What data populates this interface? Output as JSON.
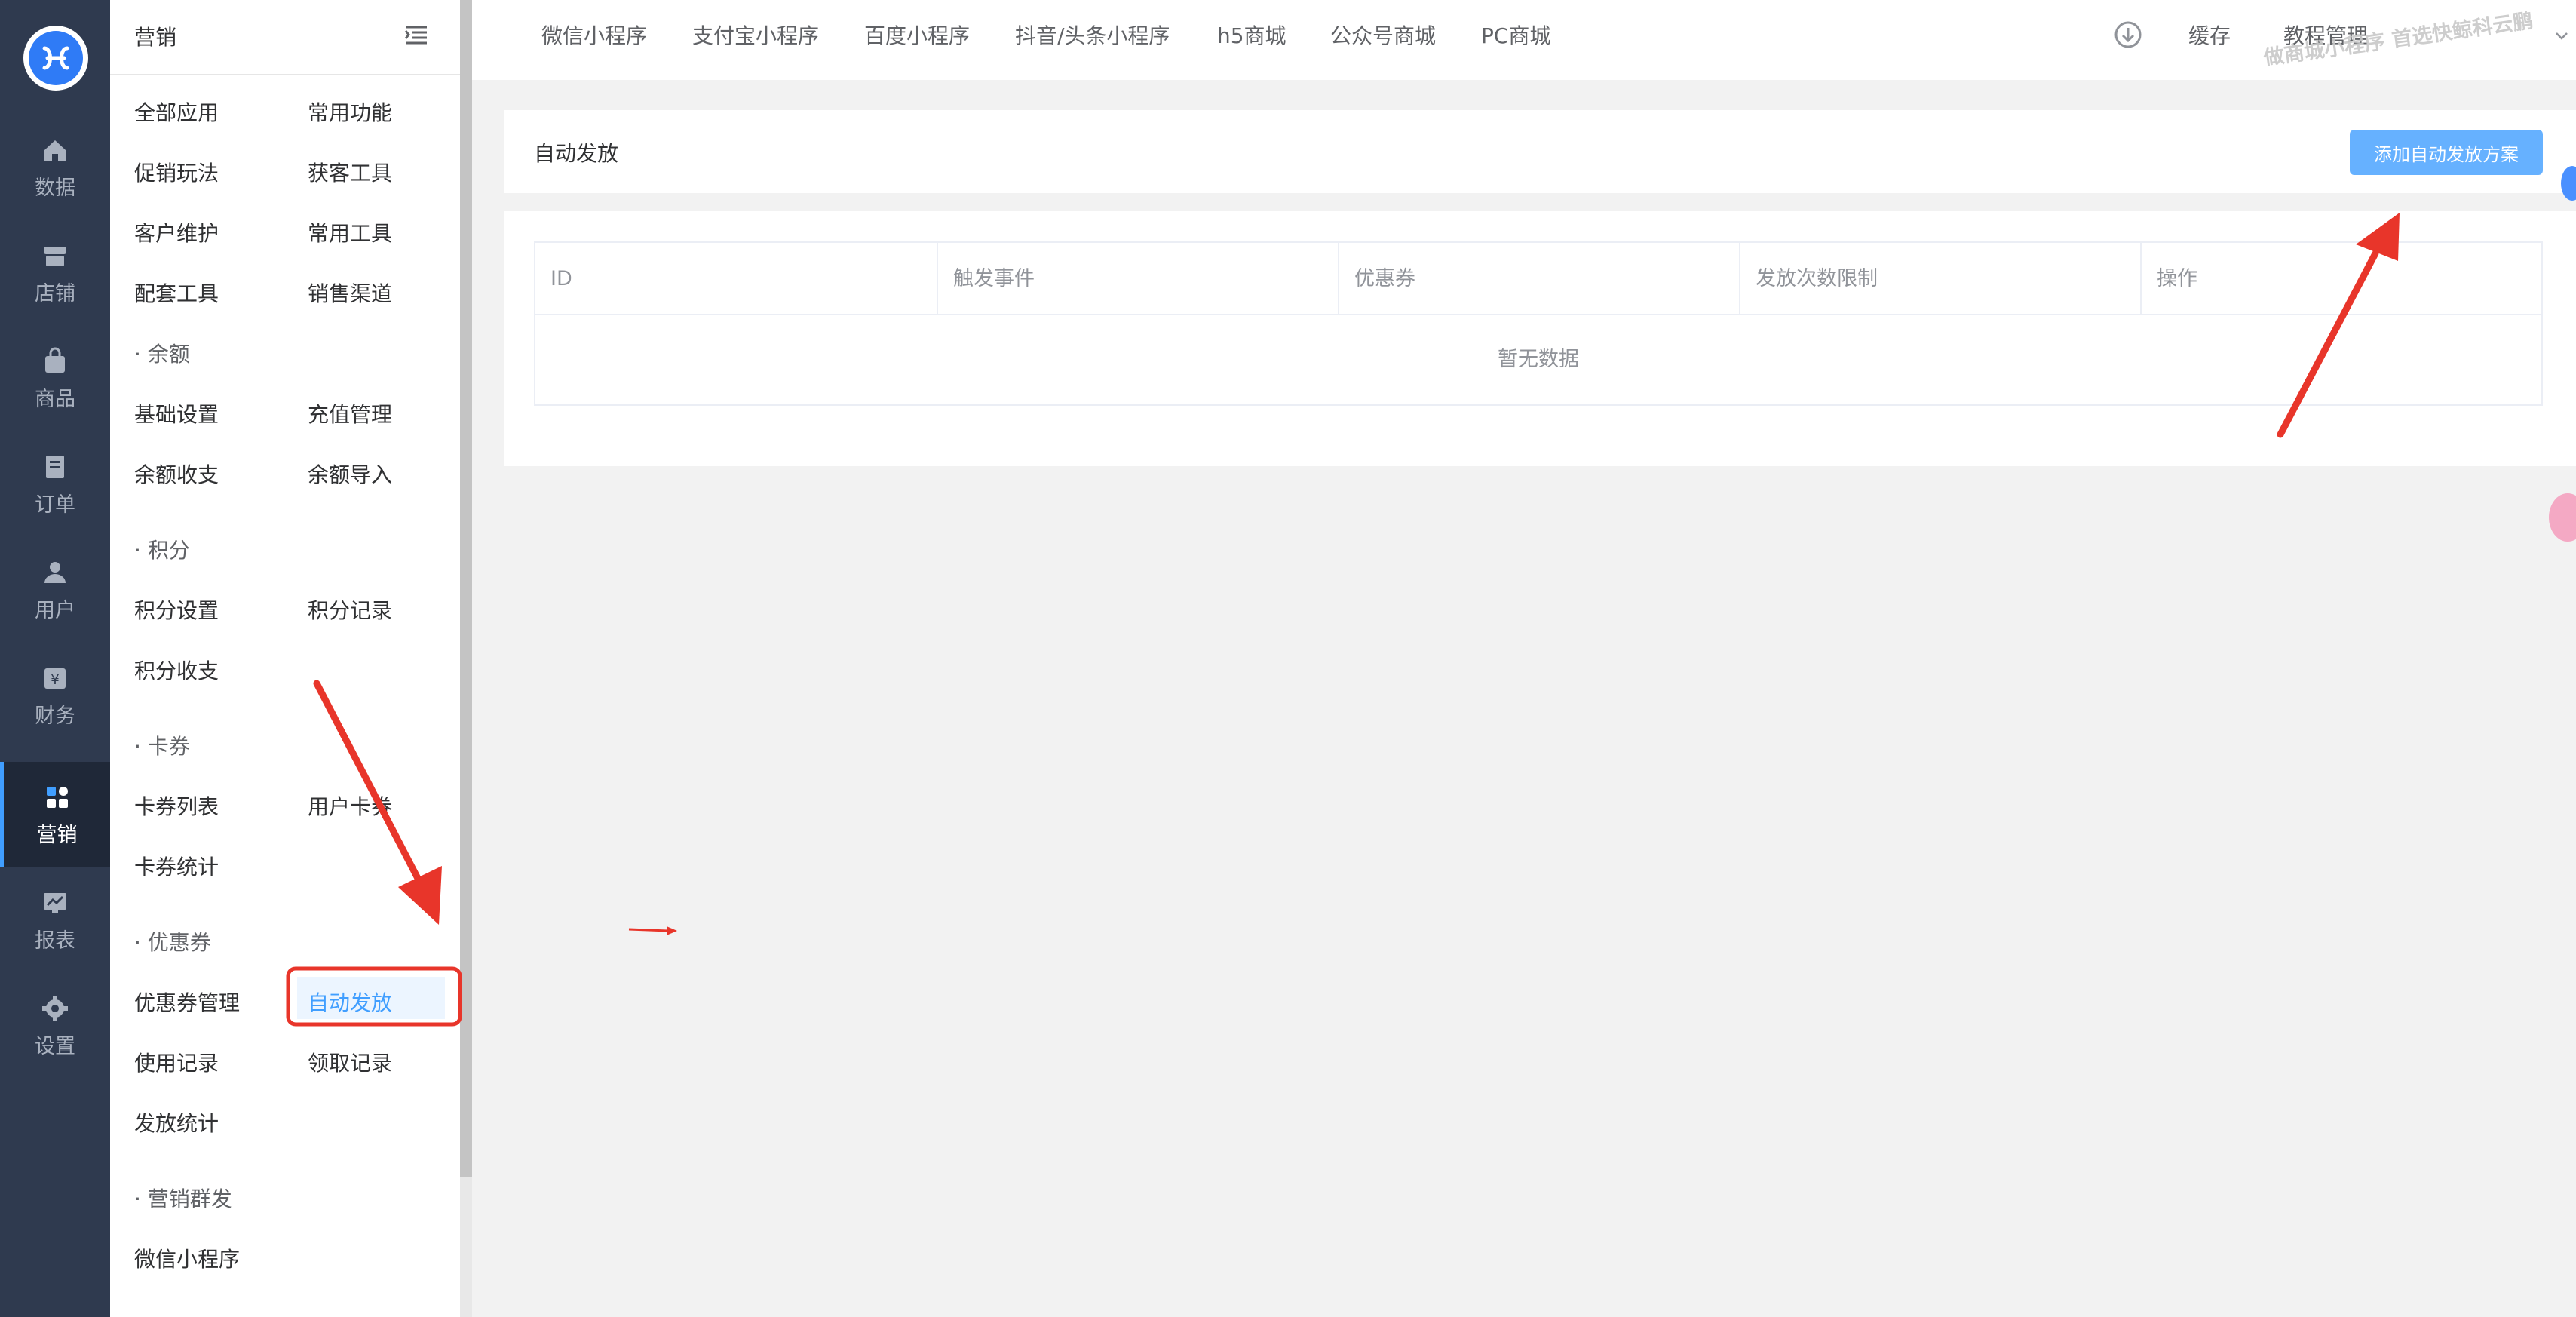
{
  "rail": {
    "items": [
      {
        "label": "数据",
        "icon": "home-icon"
      },
      {
        "label": "店铺",
        "icon": "store-icon"
      },
      {
        "label": "商品",
        "icon": "bag-icon"
      },
      {
        "label": "订单",
        "icon": "order-icon"
      },
      {
        "label": "用户",
        "icon": "user-icon"
      },
      {
        "label": "财务",
        "icon": "finance-icon"
      },
      {
        "label": "营销",
        "icon": "grid-icon"
      },
      {
        "label": "报表",
        "icon": "chart-icon"
      },
      {
        "label": "设置",
        "icon": "gear-icon"
      }
    ],
    "active": "营销"
  },
  "menu": {
    "title": "营销",
    "row1": [
      "全部应用",
      "常用功能"
    ],
    "row2": [
      "促销玩法",
      "获客工具"
    ],
    "row3": [
      "客户维护",
      "常用工具"
    ],
    "row4": [
      "配套工具",
      "销售渠道"
    ],
    "sec_balance": "· 余额",
    "balance1": [
      "基础设置",
      "充值管理"
    ],
    "balance2": [
      "余额收支",
      "余额导入"
    ],
    "sec_points": "· 积分",
    "points1": [
      "积分设置",
      "积分记录"
    ],
    "points2": [
      "积分收支"
    ],
    "sec_cards": "· 卡券",
    "cards1": [
      "卡券列表",
      "用户卡券"
    ],
    "cards2": [
      "卡券统计"
    ],
    "sec_coupon": "· 优惠券",
    "coupon1": [
      "优惠券管理",
      "自动发放"
    ],
    "coupon2": [
      "使用记录",
      "领取记录"
    ],
    "coupon3": [
      "发放统计"
    ],
    "sec_mass": "· 营销群发",
    "mass1": [
      "微信小程序"
    ]
  },
  "topbar": {
    "nav": [
      "微信小程序",
      "支付宝小程序",
      "百度小程序",
      "抖音/头条小程序",
      "h5商城",
      "公众号商城",
      "PC商城"
    ],
    "cache": "缓存",
    "tutorial": "教程管理",
    "watermark": "做商城小程序 首选快鲸科云鹏"
  },
  "page": {
    "title": "自动发放",
    "add_button": "添加自动发放方案",
    "columns": [
      "ID",
      "触发事件",
      "优惠券",
      "发放次数限制",
      "操作"
    ],
    "empty_text": "暂无数据"
  },
  "colors": {
    "rail_bg": "#2f3a4f",
    "accent": "#409eff",
    "button": "#66b1ff",
    "annotation": "#e8352a"
  }
}
